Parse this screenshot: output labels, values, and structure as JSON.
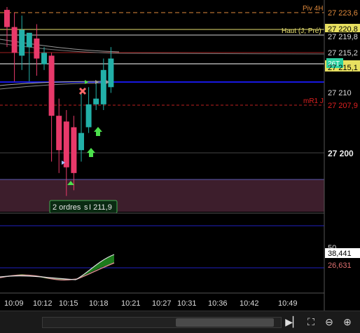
{
  "price_axis": {
    "levels": {
      "piv4h": {
        "label": "Piv 4H",
        "price": "27 223,6",
        "color": "#e08a3c"
      },
      "haut": {
        "label": "Haut (J, Pré)",
        "price": "27 220,8",
        "color": "#e8e070"
      },
      "white2": {
        "price": "27 219,8"
      },
      "red1": {
        "price": "27 215,2"
      },
      "last": {
        "price": "27 215,1",
        "tag": "26T"
      },
      "mr1": {
        "label": "mR1 J",
        "price": "27 207,9",
        "color": "#e02020"
      }
    },
    "ticks": [
      "27 210",
      "27 200"
    ]
  },
  "order_marker": {
    "label": "2 ordres",
    "suffix": "s",
    "price": "I 211,9"
  },
  "oscillator": {
    "level_label": "50",
    "values": [
      "38,441",
      "26,631"
    ]
  },
  "time_axis": [
    "10:09",
    "10:12",
    "10:15",
    "10:18",
    "10:21",
    "10:27",
    "10:31",
    "10:36",
    "10:42",
    "10:49"
  ],
  "chart_data": {
    "type": "candlestick",
    "y_range": [
      27195,
      27225
    ],
    "candles": [
      {
        "o": 27224.5,
        "h": 27225.0,
        "l": 27218.0,
        "c": 27221.5
      },
      {
        "o": 27221.5,
        "h": 27224.0,
        "l": 27212.0,
        "c": 27217.0
      },
      {
        "o": 27216.5,
        "h": 27223.5,
        "l": 27214.0,
        "c": 27221.0
      },
      {
        "o": 27218.0,
        "h": 27220.0,
        "l": 27212.0,
        "c": 27220.5
      },
      {
        "o": 27219.5,
        "h": 27222.0,
        "l": 27213.0,
        "c": 27216.0
      },
      {
        "o": 27215.0,
        "h": 27218.0,
        "l": 27214.0,
        "c": 27217.0
      },
      {
        "o": 27216.5,
        "h": 27217.0,
        "l": 27198.0,
        "c": 27206.0
      },
      {
        "o": 27206.0,
        "h": 27209.0,
        "l": 27196.0,
        "c": 27200.0
      },
      {
        "o": 27205.0,
        "h": 27207.0,
        "l": 27192.0,
        "c": 27197.0
      },
      {
        "o": 27204.0,
        "h": 27206.0,
        "l": 27193.0,
        "c": 27196.0
      },
      {
        "o": 27200.0,
        "h": 27210.0,
        "l": 27198.0,
        "c": 27203.0
      },
      {
        "o": 27204.0,
        "h": 27211.0,
        "l": 27203.0,
        "c": 27208.0
      },
      {
        "o": 27208.0,
        "h": 27212.0,
        "l": 27207.0,
        "c": 27209.0
      },
      {
        "o": 27208.0,
        "h": 27216.0,
        "l": 27207.0,
        "c": 27214.0
      },
      {
        "o": 27211.0,
        "h": 27218.0,
        "l": 27210.0,
        "c": 27216.0
      }
    ]
  },
  "colors": {
    "bull": "#22b0a8",
    "bear": "#e8396a",
    "blue_line": "#1818e0",
    "zone": "#3d1e2c"
  }
}
